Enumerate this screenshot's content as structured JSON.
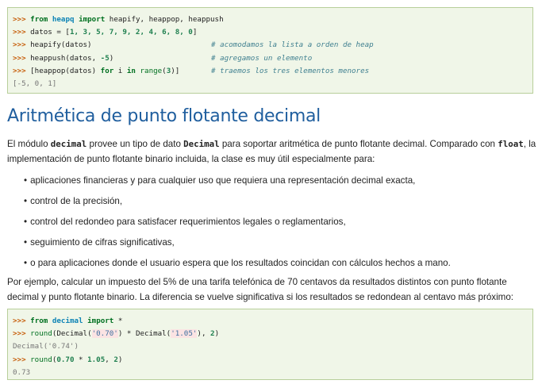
{
  "code_block_1": {
    "line1": {
      "prompt": ">>>",
      "kw_from": "from",
      "mod": "heapq",
      "kw_import": "import",
      "rest": " heapify, heappop, heappush"
    },
    "line2": {
      "prompt": ">>>",
      "pre": " datos = [",
      "nums": "1, 3, 5, 7, 9, 2, 4, 6, 8, 0",
      "post": "]"
    },
    "line3": {
      "prompt": ">>>",
      "code": " heapify(datos)",
      "comment": "# acomodamos la lista a orden de heap"
    },
    "line4": {
      "prompt": ">>>",
      "code_a": " heappush(datos, ",
      "num": "-5",
      "code_b": ")",
      "comment": "# agregamos un elemento"
    },
    "line5": {
      "prompt": ">>>",
      "code_a": " [heappop(datos) ",
      "kw_for": "for",
      "code_b": " i ",
      "kw_in": "in",
      "sp": " ",
      "builtin": "range",
      "lp": "(",
      "num": "3",
      "rp": ")]",
      "comment": "# traemos los tres elementos menores"
    },
    "output": "[-5, 0, 1]"
  },
  "heading": "Aritmética de punto flotante decimal",
  "para1": {
    "t1": "El módulo ",
    "c1": "decimal",
    "t2": " provee un tipo de dato ",
    "c2": "Decimal",
    "t3": " para soportar aritmética de punto flotante decimal. Comparado con ",
    "c3": "float",
    "t4": ", la implementación de punto flotante binario incluida, la clase es muy útil especialmente para:"
  },
  "bullets": [
    "aplicaciones financieras y para cualquier uso que requiera una representación decimal exacta,",
    "control de la precisión,",
    "control del redondeo para satisfacer requerimientos legales o reglamentarios,",
    "seguimiento de cifras significativas,",
    "o para aplicaciones donde el usuario espera que los resultados coincidan con cálculos hechos a mano."
  ],
  "para2": "Por ejemplo, calcular un impuesto del 5% de una tarifa telefónica de 70 centavos da resultados distintos con punto flotante decimal y punto flotante binario. La diferencia se vuelve significativa si los resultados se redondean al centavo más próximo:",
  "code_block_2": {
    "line1": {
      "prompt": ">>>",
      "kw_from": "from",
      "mod": "decimal",
      "kw_import": "import",
      "rest": " *"
    },
    "line2": {
      "prompt": ">>>",
      "builtin": " round",
      "a": "(Decimal(",
      "s1": "'0.70'",
      "b": ") * Decimal(",
      "s2": "'1.05'",
      "c": "), ",
      "num": "2",
      "d": ")"
    },
    "out1": "Decimal('0.74')",
    "line3": {
      "prompt": ">>>",
      "builtin": " round",
      "a": "(",
      "n1": "0.70",
      "op": " * ",
      "n2": "1.05",
      "c": ", ",
      "num": "2",
      "d": ")"
    },
    "out2": "0.73"
  },
  "colors": {
    "heading": "#1f5e9e",
    "code_bg": "#f0f6e8",
    "code_border": "#b8cf9a",
    "prompt": "#c65d09",
    "keyword": "#007020",
    "comment": "#408090"
  }
}
